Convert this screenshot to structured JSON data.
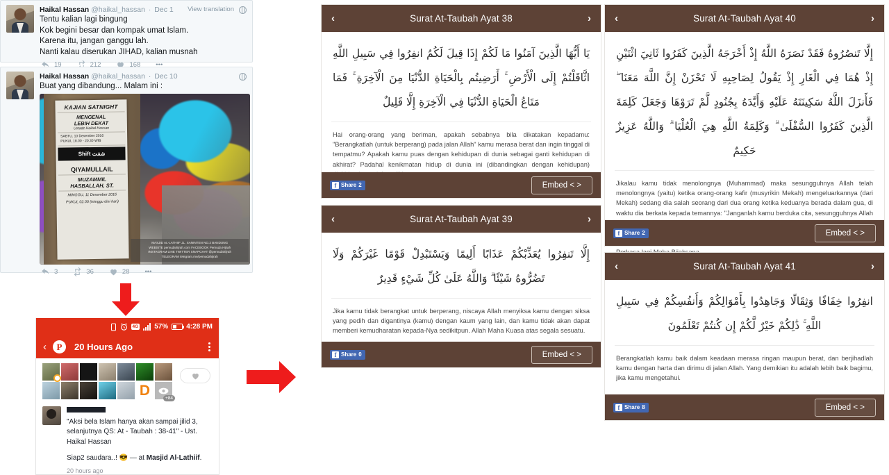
{
  "colors": {
    "verse_header": "#5d4236",
    "verse_footer": "#5d4236",
    "tweet_bg": "#f5f8fa",
    "phone_accent": "#e02f17",
    "arrow_red": "#ee1c1c",
    "facebook_blue": "#4267b2"
  },
  "tweets": [
    {
      "name": "Haikal Hassan",
      "handle": "@haikal_hassan",
      "separator": "·",
      "date": "Dec 1",
      "translate_label": "View translation",
      "lines": [
        "Tentu kalian lagi bingung",
        "Kok begini besar dan kompak umat Islam.",
        "Karena itu, jangan ganggu lah.",
        "Nanti kalau diserukan JIHAD, kalian musnah"
      ],
      "actions": {
        "reply": "19",
        "retweet": "212",
        "like": "168",
        "more": "•••"
      }
    },
    {
      "name": "Haikal Hassan",
      "handle": "@haikal_hassan",
      "separator": "·",
      "date": "Dec 10",
      "lines": [
        "Buat yang dibandung... Malam ini :"
      ],
      "actions": {
        "reply": "3",
        "retweet": "36",
        "like": "28",
        "more": "•••"
      }
    }
  ],
  "poster": {
    "title": "KAJIAN SATNIGHT",
    "subtitle_1": "MENGENAL",
    "subtitle_2": "LEBIH DEKAT",
    "speaker_1": "Ustadz Haikal Hassan",
    "date_1": "SABTU, 10 Desember 2016",
    "time_1": "PUKUL 18.00 - 20.30 WIB",
    "brand": "Shift",
    "brand_arabic": "شفت",
    "title_2": "QIYAMULLAIL",
    "speaker_2_line1": "MUZAMMIL",
    "speaker_2_line2": "HASBALLAH, ST.",
    "date_2": "MINGGU, 11 Desember 2016",
    "time_2": "PUKUL 02.00 (minggu dini hari)",
    "caption_line1": "MASJID AL-LATHIIF  JL. SANINTEN NO.2 BANDUNG",
    "caption_line2": "WEBSITE pemudahijrah.com  FACEBOOK Pemuda Hijrah",
    "caption_line3": "INSTAGRAM LINE TWITTER SNAPCHAT @pemudahijrah",
    "caption_line4": "TELEGRAM telegram.me/pemudahijrah"
  },
  "phone": {
    "status": {
      "battery_percent": "57%",
      "time": "4:28 PM",
      "network": "4G"
    },
    "nav": {
      "back": "‹",
      "logo": "P",
      "title": "20 Hours Ago",
      "menu": "kebab-menu"
    },
    "reactions": {
      "overflow_count": "+84",
      "avatar_count": 13
    },
    "post": {
      "quote_line1": "\"Aksi bela Islam hanya akan sampai jilid 3,",
      "quote_line2": "selanjutnya QS: At - Taubah : 38-41\" - Ust.",
      "quote_line3": "Haikal Hassan",
      "sub_text": "Siap2 saudara..! ",
      "sub_emoji": "😎",
      "sub_dash": " — at ",
      "place": "Masjid Al-Lathiif",
      "period": ".",
      "timestamp": "20 hours ago"
    }
  },
  "verse_cards": [
    {
      "id": "ayat-38",
      "title": "Surat At-Taubah Ayat 38",
      "prev": "‹",
      "next": "›",
      "arabic": "يَا أَيُّهَا الَّذِينَ آمَنُوا مَا لَكُمْ إِذَا قِيلَ لَكُمُ انفِرُوا فِي سَبِيلِ اللَّهِ اثَّاقَلْتُمْ إِلَى الْأَرْضِ ۚ أَرَضِيتُم بِالْحَيَاةِ الدُّنْيَا مِنَ الْآخِرَةِ ۚ فَمَا مَتَاعُ الْحَيَاةِ الدُّنْيَا فِي الْآخِرَةِ إِلَّا قَلِيلٌ",
      "translation": "Hai orang-orang yang beriman, apakah sebabnya bila dikatakan kepadamu: \"Berangkatlah (untuk berperang) pada jalan Allah\" kamu merasa berat dan ingin tinggal di tempatmu? Apakah kamu puas dengan kehidupan di dunia sebagai ganti kehidupan di akhirat? Padahal kenikmatan hidup di dunia ini (dibandingkan dengan kehidupan) diakhirat hanyalah sedikit.",
      "share_label": "Share",
      "share_count": "2",
      "embed_label": "Embed < >"
    },
    {
      "id": "ayat-39",
      "title": "Surat At-Taubah Ayat 39",
      "prev": "‹",
      "next": "›",
      "arabic": "إِلَّا تَنفِرُوا يُعَذِّبْكُمْ عَذَابًا أَلِيمًا وَيَسْتَبْدِلْ قَوْمًا غَيْرَكُمْ وَلَا تَضُرُّوهُ شَيْئًا ۗ وَاللَّهُ عَلَىٰ كُلِّ شَيْءٍ قَدِيرٌ",
      "translation": "Jika kamu tidak berangkat untuk berperang, niscaya Allah menyiksa kamu dengan siksa yang pedih dan digantinya (kamu) dengan kaum yang lain, dan kamu tidak akan dapat memberi kemudharatan kepada-Nya sedikitpun. Allah Maha Kuasa atas segala sesuatu.",
      "share_label": "Share",
      "share_count": "0",
      "embed_label": "Embed < >"
    },
    {
      "id": "ayat-40",
      "title": "Surat At-Taubah Ayat 40",
      "prev": "‹",
      "next": "›",
      "arabic": "إِلَّا تَنصُرُوهُ فَقَدْ نَصَرَهُ اللَّهُ إِذْ أَخْرَجَهُ الَّذِينَ كَفَرُوا ثَانِيَ اثْنَيْنِ إِذْ هُمَا فِي الْغَارِ إِذْ يَقُولُ لِصَاحِبِهِ لَا تَحْزَنْ إِنَّ اللَّهَ مَعَنَا ۖ فَأَنزَلَ اللَّهُ سَكِينَتَهُ عَلَيْهِ وَأَيَّدَهُ بِجُنُودٍ لَّمْ تَرَوْهَا وَجَعَلَ كَلِمَةَ الَّذِينَ كَفَرُوا السُّفْلَىٰ ۗ وَكَلِمَةُ اللَّهِ هِيَ الْعُلْيَا ۗ وَاللَّهُ عَزِيزٌ حَكِيمٌ",
      "translation": "Jikalau kamu tidak menolongnya (Muhammad) maka sesungguhnya Allah telah menolongnya (yaitu) ketika orang-orang kafir (musyrikin Mekah) mengeluarkannya (dari Mekah) sedang dia salah seorang dari dua orang ketika keduanya berada dalam gua, di waktu dia berkata kepada temannya: \"Janganlah kamu berduka cita, sesungguhnya Allah beserta kita\". Maka Allah menurunkan keterangan-Nya kepada (Muhammad) dan membantunya dengan tentara yang kamu tidak melihatnya, dan Al-Quran menjadikan orang-orang kafir itulah yang rendah. Dan kalimat Allah itulah yang tinggi. Allah Maha Perkasa lagi Maha Bijaksana.",
      "share_label": "Share",
      "share_count": "2",
      "embed_label": "Embed < >"
    },
    {
      "id": "ayat-41",
      "title": "Surat At-Taubah Ayat 41",
      "prev": "‹",
      "next": "›",
      "arabic": "انفِرُوا خِفَافًا وَثِقَالًا وَجَاهِدُوا بِأَمْوَالِكُمْ وَأَنفُسِكُمْ فِي سَبِيلِ اللَّهِ ۚ ذَٰلِكُمْ خَيْرٌ لَّكُمْ إِن كُنتُمْ تَعْلَمُونَ",
      "translation": "Berangkatlah kamu baik dalam keadaan merasa ringan maupun berat, dan berjihadlah kamu dengan harta dan dirimu di jalan Allah. Yang demikian itu adalah lebih baik bagimu, jika kamu mengetahui.",
      "share_label": "Share",
      "share_count": "8",
      "embed_label": "Embed < >"
    }
  ]
}
